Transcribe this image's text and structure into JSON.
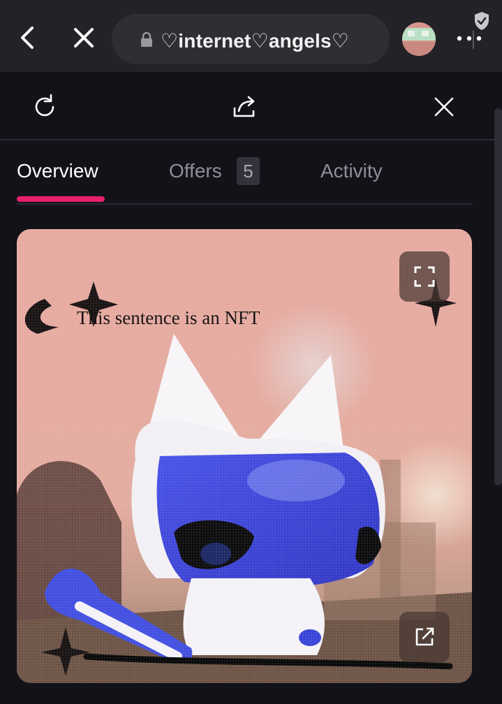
{
  "browser": {
    "url_title": "♡internet♡angels♡",
    "icons": [
      "back-arrow-icon",
      "close-icon",
      "lock-icon",
      "avatar",
      "shield-check-icon",
      "more-horizontal-icon"
    ]
  },
  "actions": {
    "icons": [
      "refresh-icon",
      "share-icon",
      "close-icon"
    ]
  },
  "tabs": {
    "overview": "Overview",
    "offers": "Offers",
    "offers_count": "5",
    "activity": "Activity",
    "active": "overview"
  },
  "nft": {
    "caption": "This sentence is an NFT",
    "icons": [
      "expand-icon",
      "open-external-icon"
    ]
  },
  "colors": {
    "accent": "#e8206e",
    "background": "#141219",
    "browser_bar": "#232227",
    "muted_text": "#8f8d96"
  }
}
